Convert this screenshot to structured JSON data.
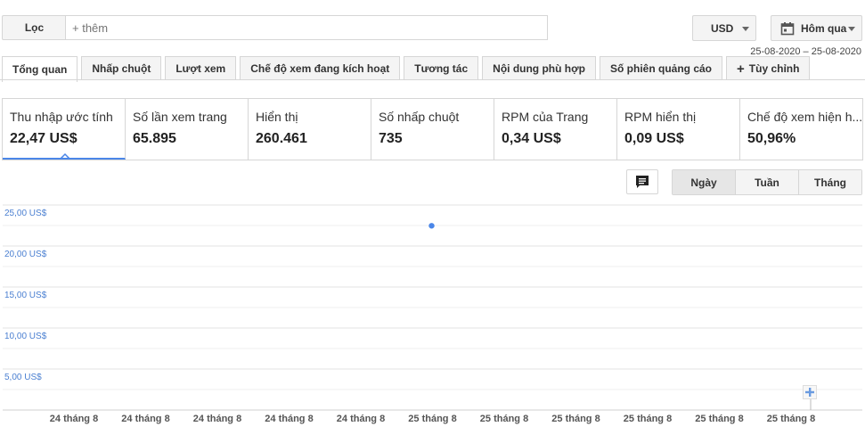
{
  "filter": {
    "label": "Lọc",
    "placeholder": "+ thêm"
  },
  "currency": {
    "label": "USD"
  },
  "date_selector": {
    "label": "Hôm qua",
    "range": "25-08-2020 – 25-08-2020"
  },
  "tabs": [
    {
      "label": "Tổng quan",
      "active": true
    },
    {
      "label": "Nhấp chuột",
      "active": false
    },
    {
      "label": "Lượt xem",
      "active": false
    },
    {
      "label": "Chế độ xem đang kích hoạt",
      "active": false
    },
    {
      "label": "Tương tác",
      "active": false
    },
    {
      "label": "Nội dung phù hợp",
      "active": false
    },
    {
      "label": "Số phiên quảng cáo",
      "active": false
    },
    {
      "label": "Tùy chỉnh",
      "active": false
    }
  ],
  "metrics": [
    {
      "label": "Thu nhập ước tính",
      "value": "22,47 US$",
      "active": true
    },
    {
      "label": "Số lần xem trang",
      "value": "65.895",
      "active": false
    },
    {
      "label": "Hiển thị",
      "value": "260.461",
      "active": false
    },
    {
      "label": "Số nhấp chuột",
      "value": "735",
      "active": false
    },
    {
      "label": "RPM của Trang",
      "value": "0,34 US$",
      "active": false
    },
    {
      "label": "RPM hiển thị",
      "value": "0,09 US$",
      "active": false
    },
    {
      "label": "Chế độ xem hiện h...",
      "value": "50,96%",
      "active": false
    }
  ],
  "periods": [
    {
      "label": "Ngày",
      "active": true
    },
    {
      "label": "Tuần",
      "active": false
    },
    {
      "label": "Tháng",
      "active": false
    }
  ],
  "colors": {
    "accent": "#4a86e8",
    "axis_label": "#4a7fd1"
  },
  "chart_data": {
    "type": "scatter",
    "y_tick_labels": [
      "25,00 US$",
      "20,00 US$",
      "15,00 US$",
      "10,00 US$",
      "5,00 US$"
    ],
    "y_ticks": [
      25,
      20,
      15,
      10,
      5
    ],
    "ylim": [
      0,
      25
    ],
    "x_tick_labels": [
      "24 tháng 8",
      "24 tháng 8",
      "24 tháng 8",
      "24 tháng 8",
      "24 tháng 8",
      "25 tháng 8",
      "25 tháng 8",
      "25 tháng 8",
      "25 tháng 8",
      "25 tháng 8",
      "25 tháng 8"
    ],
    "points": [
      {
        "x_index": 5,
        "y": 22.47
      }
    ],
    "grid": true
  }
}
